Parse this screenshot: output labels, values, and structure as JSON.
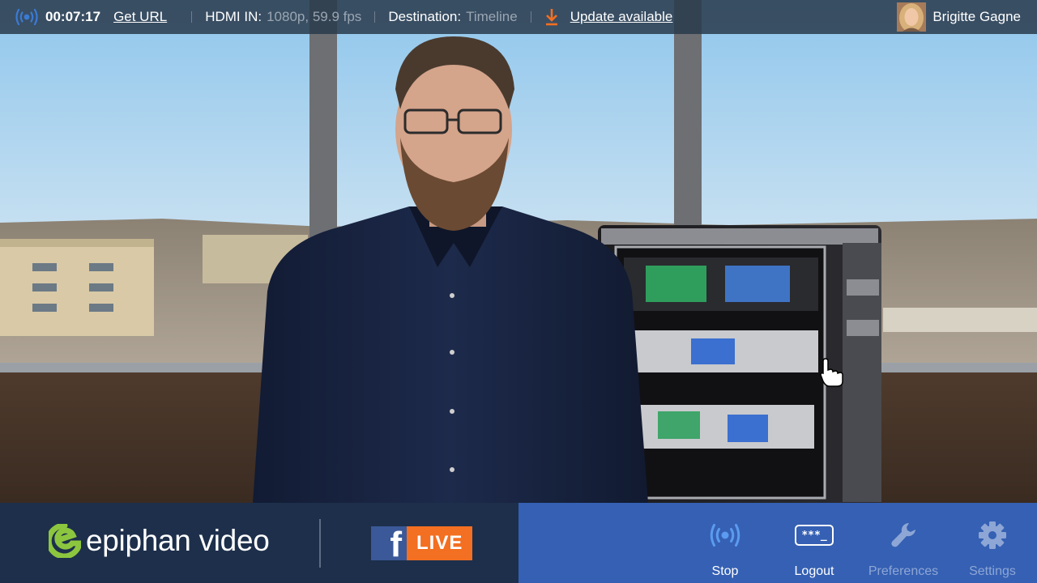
{
  "topbar": {
    "timer": "00:07:17",
    "get_url": "Get URL",
    "input_label": "HDMI IN:",
    "input_value": "1080p, 59.9 fps",
    "destination_label": "Destination:",
    "destination_value": "Timeline",
    "update_label": "Update available",
    "user_name": "Brigitte Gagne"
  },
  "branding": {
    "logo_text": "epiphan video",
    "fb_letter": "f",
    "live_label": "LIVE"
  },
  "controls": [
    {
      "label": "Stop",
      "icon": "broadcast-icon",
      "enabled": true
    },
    {
      "label": "Logout",
      "icon": "password-icon",
      "icon_text": "***_",
      "enabled": true
    },
    {
      "label": "Preferences",
      "icon": "wrench-icon",
      "enabled": false
    },
    {
      "label": "Settings",
      "icon": "gear-icon",
      "enabled": false
    }
  ],
  "colors": {
    "topbar_bg": "#2a3a4c",
    "accent_blue": "#3a7bd5",
    "update_orange": "#f36f21",
    "bottom_left_bg": "#1d2f4b",
    "bottom_right_bg": "#3560b3",
    "facebook_blue": "#3b5998",
    "live_orange": "#f36f21",
    "logo_green": "#8cc63f"
  }
}
